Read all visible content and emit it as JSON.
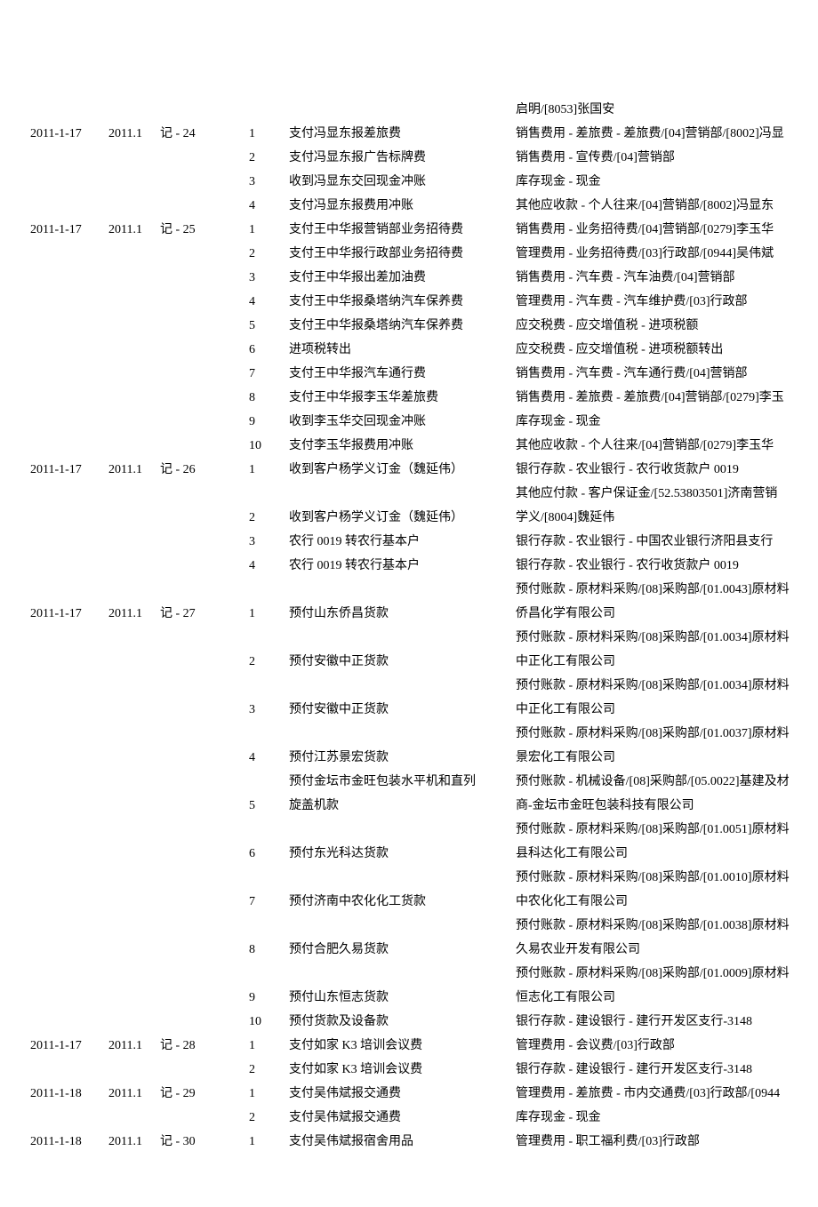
{
  "rows": [
    {
      "date": "",
      "period": "",
      "voucher": "",
      "line": "",
      "summary": "",
      "account": "启明/[8053]张国安"
    },
    {
      "date": "2011-1-17",
      "period": "2011.1",
      "voucher": "记 - 24",
      "line": "1",
      "summary": "支付冯显东报差旅费",
      "account": "销售费用 - 差旅费 - 差旅费/[04]营销部/[8002]冯显"
    },
    {
      "date": "",
      "period": "",
      "voucher": "",
      "line": "2",
      "summary": "支付冯显东报广告标牌费",
      "account": "销售费用 - 宣传费/[04]营销部"
    },
    {
      "date": "",
      "period": "",
      "voucher": "",
      "line": "3",
      "summary": "收到冯显东交回现金冲账",
      "account": "库存现金 - 现金"
    },
    {
      "date": "",
      "period": "",
      "voucher": "",
      "line": "4",
      "summary": "支付冯显东报费用冲账",
      "account": "其他应收款 - 个人往来/[04]营销部/[8002]冯显东"
    },
    {
      "date": "2011-1-17",
      "period": "2011.1",
      "voucher": "记 - 25",
      "line": "1",
      "summary": "支付王中华报营销部业务招待费",
      "account": "销售费用 - 业务招待费/[04]营销部/[0279]李玉华"
    },
    {
      "date": "",
      "period": "",
      "voucher": "",
      "line": "2",
      "summary": "支付王中华报行政部业务招待费",
      "account": "管理费用 - 业务招待费/[03]行政部/[0944]吴伟斌"
    },
    {
      "date": "",
      "period": "",
      "voucher": "",
      "line": "3",
      "summary": "支付王中华报出差加油费",
      "account": "销售费用 - 汽车费 - 汽车油费/[04]营销部"
    },
    {
      "date": "",
      "period": "",
      "voucher": "",
      "line": "4",
      "summary": "支付王中华报桑塔纳汽车保养费",
      "account": "管理费用 - 汽车费 - 汽车维护费/[03]行政部"
    },
    {
      "date": "",
      "period": "",
      "voucher": "",
      "line": "5",
      "summary": "支付王中华报桑塔纳汽车保养费",
      "account": "应交税费 - 应交增值税 - 进项税额"
    },
    {
      "date": "",
      "period": "",
      "voucher": "",
      "line": "6",
      "summary": "进项税转出",
      "account": "应交税费 - 应交增值税 - 进项税额转出"
    },
    {
      "date": "",
      "period": "",
      "voucher": "",
      "line": "7",
      "summary": "支付王中华报汽车通行费",
      "account": "销售费用 - 汽车费 - 汽车通行费/[04]营销部"
    },
    {
      "date": "",
      "period": "",
      "voucher": "",
      "line": "8",
      "summary": "支付王中华报李玉华差旅费",
      "account": "销售费用 - 差旅费 - 差旅费/[04]营销部/[0279]李玉"
    },
    {
      "date": "",
      "period": "",
      "voucher": "",
      "line": "9",
      "summary": "收到李玉华交回现金冲账",
      "account": "库存现金 - 现金"
    },
    {
      "date": "",
      "period": "",
      "voucher": "",
      "line": "10",
      "summary": "支付李玉华报费用冲账",
      "account": "其他应收款 - 个人往来/[04]营销部/[0279]李玉华"
    },
    {
      "date": "2011-1-17",
      "period": "2011.1",
      "voucher": "记 - 26",
      "line": "1",
      "summary": "收到客户杨学义订金（魏延伟）",
      "account": "银行存款 - 农业银行 - 农行收货款户 0019"
    },
    {
      "date": "",
      "period": "",
      "voucher": "",
      "line": "",
      "summary": "",
      "account": "其他应付款 - 客户保证金/[52.53803501]济南营销"
    },
    {
      "date": "",
      "period": "",
      "voucher": "",
      "line": "2",
      "summary": "收到客户杨学义订金（魏延伟）",
      "account": "学义/[8004]魏延伟"
    },
    {
      "date": "",
      "period": "",
      "voucher": "",
      "line": "3",
      "summary": "农行 0019 转农行基本户",
      "account": "银行存款 - 农业银行 - 中国农业银行济阳县支行"
    },
    {
      "date": "",
      "period": "",
      "voucher": "",
      "line": "4",
      "summary": "农行 0019 转农行基本户",
      "account": "银行存款 - 农业银行 - 农行收货款户 0019"
    },
    {
      "date": "",
      "period": "",
      "voucher": "",
      "line": "",
      "summary": "",
      "account": "预付账款 - 原材料采购/[08]采购部/[01.0043]原材料"
    },
    {
      "date": "2011-1-17",
      "period": "2011.1",
      "voucher": "记 - 27",
      "line": "1",
      "summary": "预付山东侨昌货款",
      "account": "侨昌化学有限公司"
    },
    {
      "date": "",
      "period": "",
      "voucher": "",
      "line": "",
      "summary": "",
      "account": "预付账款 - 原材料采购/[08]采购部/[01.0034]原材料"
    },
    {
      "date": "",
      "period": "",
      "voucher": "",
      "line": "2",
      "summary": "预付安徽中正货款",
      "account": "中正化工有限公司"
    },
    {
      "date": "",
      "period": "",
      "voucher": "",
      "line": "",
      "summary": "",
      "account": "预付账款 - 原材料采购/[08]采购部/[01.0034]原材料"
    },
    {
      "date": "",
      "period": "",
      "voucher": "",
      "line": "3",
      "summary": "预付安徽中正货款",
      "account": "中正化工有限公司"
    },
    {
      "date": "",
      "period": "",
      "voucher": "",
      "line": "",
      "summary": "",
      "account": "预付账款 - 原材料采购/[08]采购部/[01.0037]原材料"
    },
    {
      "date": "",
      "period": "",
      "voucher": "",
      "line": "4",
      "summary": "预付江苏景宏货款",
      "account": "景宏化工有限公司"
    },
    {
      "date": "",
      "period": "",
      "voucher": "",
      "line": "",
      "summary": "预付金坛市金旺包装水平机和直列",
      "account": "预付账款 - 机械设备/[08]采购部/[05.0022]基建及材"
    },
    {
      "date": "",
      "period": "",
      "voucher": "",
      "line": "5",
      "summary": "旋盖机款",
      "account": "商-金坛市金旺包装科技有限公司"
    },
    {
      "date": "",
      "period": "",
      "voucher": "",
      "line": "",
      "summary": "",
      "account": "预付账款 - 原材料采购/[08]采购部/[01.0051]原材料"
    },
    {
      "date": "",
      "period": "",
      "voucher": "",
      "line": "6",
      "summary": "预付东光科达货款",
      "account": "县科达化工有限公司"
    },
    {
      "date": "",
      "period": "",
      "voucher": "",
      "line": "",
      "summary": "",
      "account": "预付账款 - 原材料采购/[08]采购部/[01.0010]原材料"
    },
    {
      "date": "",
      "period": "",
      "voucher": "",
      "line": "7",
      "summary": "预付济南中农化化工货款",
      "account": "中农化化工有限公司"
    },
    {
      "date": "",
      "period": "",
      "voucher": "",
      "line": "",
      "summary": "",
      "account": "预付账款 - 原材料采购/[08]采购部/[01.0038]原材料"
    },
    {
      "date": "",
      "period": "",
      "voucher": "",
      "line": "8",
      "summary": "预付合肥久易货款",
      "account": "久易农业开发有限公司"
    },
    {
      "date": "",
      "period": "",
      "voucher": "",
      "line": "",
      "summary": "",
      "account": "预付账款 - 原材料采购/[08]采购部/[01.0009]原材料"
    },
    {
      "date": "",
      "period": "",
      "voucher": "",
      "line": "9",
      "summary": "预付山东恒志货款",
      "account": "恒志化工有限公司"
    },
    {
      "date": "",
      "period": "",
      "voucher": "",
      "line": "10",
      "summary": "预付货款及设备款",
      "account": "银行存款 - 建设银行 - 建行开发区支行-3148"
    },
    {
      "date": "2011-1-17",
      "period": "2011.1",
      "voucher": "记 - 28",
      "line": "1",
      "summary": "支付如家 K3 培训会议费",
      "account": "管理费用 - 会议费/[03]行政部"
    },
    {
      "date": "",
      "period": "",
      "voucher": "",
      "line": "2",
      "summary": "支付如家 K3 培训会议费",
      "account": "银行存款 - 建设银行 - 建行开发区支行-3148"
    },
    {
      "date": "2011-1-18",
      "period": "2011.1",
      "voucher": "记 - 29",
      "line": "1",
      "summary": "支付吴伟斌报交通费",
      "account": "管理费用 - 差旅费 - 市内交通费/[03]行政部/[0944"
    },
    {
      "date": "",
      "period": "",
      "voucher": "",
      "line": "2",
      "summary": "支付吴伟斌报交通费",
      "account": "库存现金 - 现金"
    },
    {
      "date": "2011-1-18",
      "period": "2011.1",
      "voucher": "记 - 30",
      "line": "1",
      "summary": "支付吴伟斌报宿舍用品",
      "account": "管理费用 - 职工福利费/[03]行政部"
    }
  ]
}
